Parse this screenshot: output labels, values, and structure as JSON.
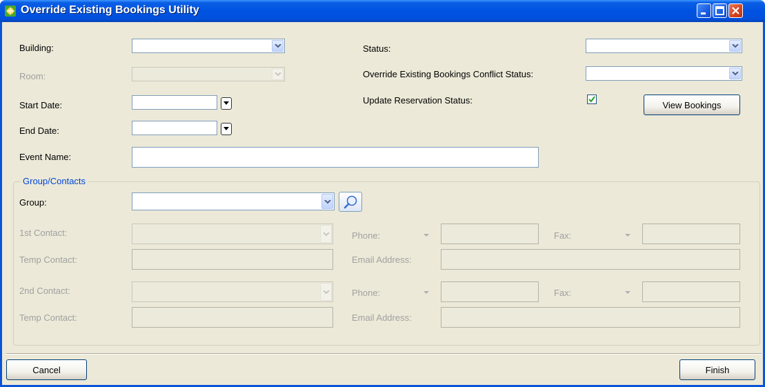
{
  "window": {
    "title": "Override Existing Bookings Utility",
    "controls": [
      "minimize-icon",
      "maximize-icon",
      "close-icon"
    ]
  },
  "form": {
    "building_label": "Building:",
    "room_label": "Room:",
    "start_date_label": "Start Date:",
    "end_date_label": "End Date:",
    "event_name_label": "Event Name:",
    "status_label": "Status:",
    "override_conflict_label": "Override Existing Bookings Conflict Status:",
    "update_reservation_label": "Update Reservation Status:",
    "update_reservation_checked": true,
    "view_bookings_label": "View Bookings"
  },
  "group_contacts": {
    "legend": "Group/Contacts",
    "group_label": "Group:",
    "contact1": {
      "label": "1st Contact:",
      "temp_label": "Temp Contact:",
      "phone_label": "Phone:",
      "fax_label": "Fax:",
      "email_label": "Email Address:"
    },
    "contact2": {
      "label": "2nd Contact:",
      "temp_label": "Temp Contact:",
      "phone_label": "Phone:",
      "fax_label": "Fax:",
      "email_label": "Email Address:"
    }
  },
  "footer": {
    "cancel_label": "Cancel",
    "finish_label": "Finish"
  },
  "colors": {
    "titlebar": "#0053e1",
    "window_bg": "#ece9d8",
    "legend_text": "#0046d5",
    "disabled_text": "#a0a0a0"
  }
}
